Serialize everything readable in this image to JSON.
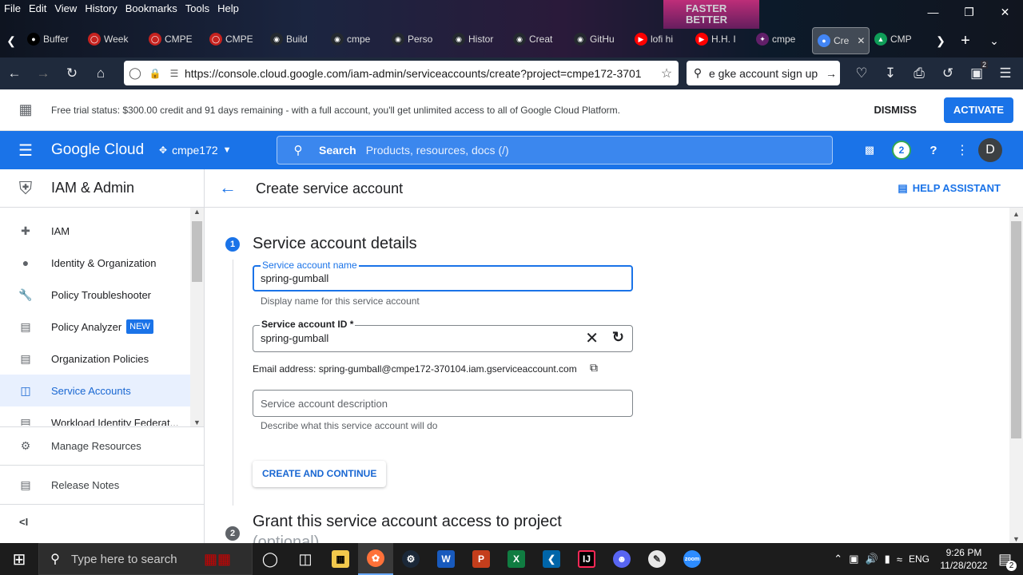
{
  "browser": {
    "menu": [
      "File",
      "Edit",
      "View",
      "History",
      "Bookmarks",
      "Tools",
      "Help"
    ],
    "tabs": [
      {
        "label": "Buffer",
        "color": "#000000",
        "icon": "buffer-icon"
      },
      {
        "label": "Week",
        "color": "#c5221f",
        "icon": "circle-icon"
      },
      {
        "label": "CMPE",
        "color": "#c5221f",
        "icon": "circle-icon"
      },
      {
        "label": "CMPE",
        "color": "#c5221f",
        "icon": "circle-icon"
      },
      {
        "label": "Build",
        "color": "#24292f",
        "icon": "github-icon"
      },
      {
        "label": "cmpe",
        "color": "#24292f",
        "icon": "github-icon"
      },
      {
        "label": "Perso",
        "color": "#24292f",
        "icon": "github-icon"
      },
      {
        "label": "Histor",
        "color": "#24292f",
        "icon": "github-icon"
      },
      {
        "label": "Creat",
        "color": "#24292f",
        "icon": "github-icon"
      },
      {
        "label": "GitHu",
        "color": "#24292f",
        "icon": "github-icon"
      },
      {
        "label": "lofi hi",
        "color": "#ff0000",
        "icon": "youtube-icon"
      },
      {
        "label": "H.H. I",
        "color": "#ff0000",
        "icon": "youtube-icon"
      },
      {
        "label": "cmpe",
        "color": "#611f69",
        "icon": "slack-icon"
      },
      {
        "label": "Cre",
        "color": "#4285f4",
        "icon": "gcp-icon"
      },
      {
        "label": "CMP",
        "color": "#0f9d58",
        "icon": "drive-icon"
      }
    ],
    "url": "https://console.cloud.google.com/iam-admin/serviceaccounts/create?project=cmpe172-3701",
    "search_text": "e gke account sign up",
    "notif_badge": "2"
  },
  "trial": {
    "message": "Free trial status: $300.00 credit and 91 days remaining - with a full account, you'll get unlimited access to all of Google Cloud Platform.",
    "dismiss": "DISMISS",
    "activate": "ACTIVATE"
  },
  "header": {
    "logo": "Google Cloud",
    "project": "cmpe172",
    "search_label": "Search",
    "search_placeholder": "Products, resources, docs (/)",
    "notif_count": "2",
    "avatar": "D"
  },
  "sidebar": {
    "title": "IAM & Admin",
    "items": [
      {
        "label": "IAM",
        "icon": "person-add-icon"
      },
      {
        "label": "Identity & Organization",
        "icon": "account-circle-icon"
      },
      {
        "label": "Policy Troubleshooter",
        "icon": "wrench-icon"
      },
      {
        "label": "Policy Analyzer",
        "icon": "document-search-icon",
        "badge": "NEW"
      },
      {
        "label": "Organization Policies",
        "icon": "list-icon"
      },
      {
        "label": "Service Accounts",
        "icon": "service-account-icon",
        "selected": true
      },
      {
        "label": "Workload Identity Federat...",
        "icon": "id-card-icon"
      }
    ],
    "bottom": [
      {
        "label": "Manage Resources",
        "icon": "gear-box-icon"
      },
      {
        "label": "Release Notes",
        "icon": "notes-icon"
      }
    ],
    "collapse": "<I"
  },
  "page": {
    "title": "Create service account",
    "help_assistant": "HELP ASSISTANT",
    "step1": {
      "num": "1",
      "title": "Service account details",
      "name_label": "Service account name",
      "name_value": "spring-gumball",
      "name_hint": "Display name for this service account",
      "id_label": "Service account ID *",
      "id_value": "spring-gumball",
      "email": "Email address: spring-gumball@cmpe172-370104.iam.gserviceaccount.com",
      "desc_placeholder": "Service account description",
      "desc_hint": "Describe what this service account will do",
      "create_button": "CREATE AND CONTINUE"
    },
    "step2": {
      "num": "2",
      "title": "Grant this service account access to project",
      "subtitle": "(optional)"
    }
  },
  "taskbar": {
    "search_placeholder": "Type here to search",
    "lang": "ENG",
    "time": "9:26 PM",
    "date": "11/28/2022",
    "notif": "2"
  }
}
